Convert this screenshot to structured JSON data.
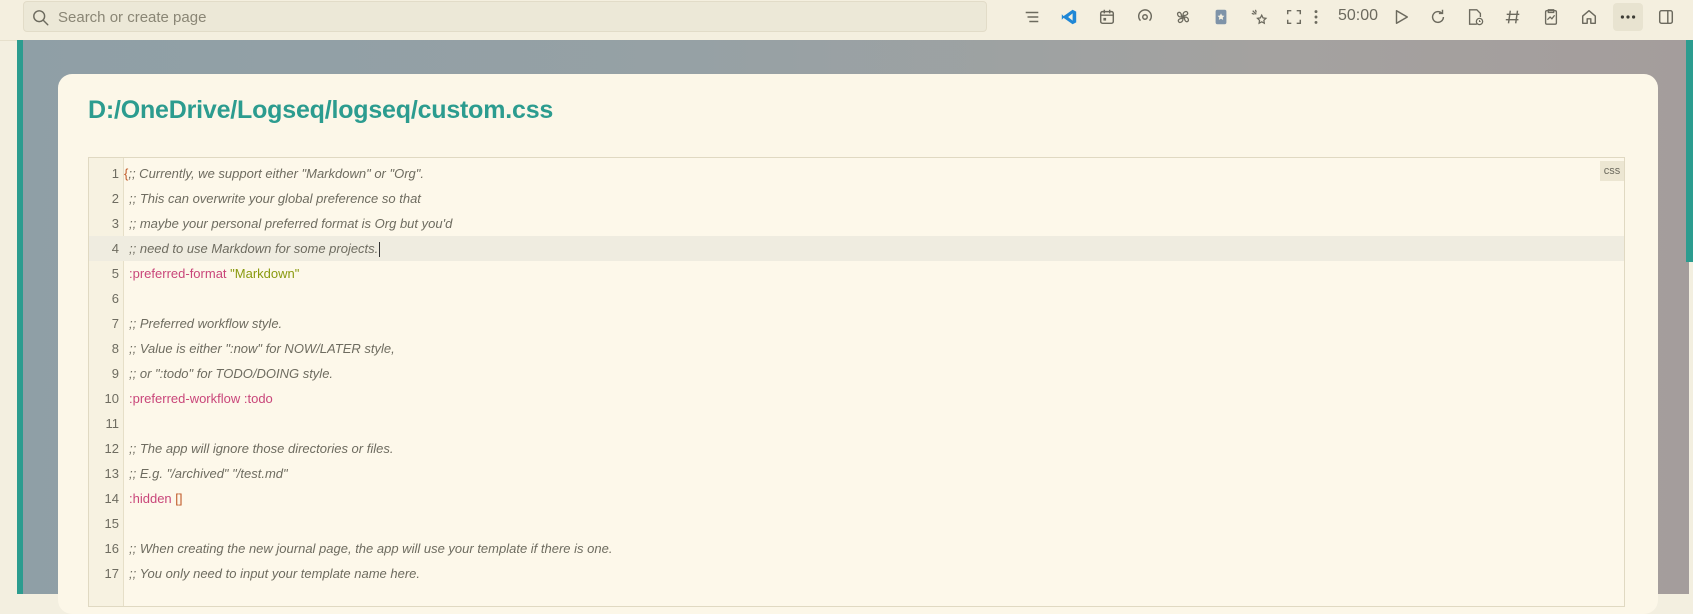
{
  "search": {
    "placeholder": "Search or create page"
  },
  "toolbar": {
    "icons": [
      "list-icon",
      "vscode-icon",
      "calendar-icon",
      "podcast-icon",
      "fan-icon",
      "bookmark-icon",
      "stars-icon",
      "fullscreen-icon",
      "vertical-dots-icon",
      "play-icon",
      "refresh-icon",
      "page-clock-icon",
      "hashtag-icon",
      "clipboard-chart-icon",
      "home-icon",
      "more-icon",
      "sidebar-toggle-icon"
    ],
    "timer": "50:00",
    "more_label": "···"
  },
  "page": {
    "title": "D:/OneDrive/Logseq/logseq/custom.css"
  },
  "editor": {
    "language": "css",
    "active_line": 4,
    "lines": [
      {
        "n": "1",
        "first": "{",
        "text": ";; Currently, we support either \"Markdown\" or \"Org\"."
      },
      {
        "n": "2",
        "text": ";; This can overwrite your global preference so that"
      },
      {
        "n": "3",
        "text": ";; maybe your personal preferred format is Org but you'd"
      },
      {
        "n": "4",
        "text": ";; need to use Markdown for some projects."
      },
      {
        "n": "5",
        "key": ":preferred-format",
        "value": "\"Markdown\""
      },
      {
        "n": "6",
        "text": ""
      },
      {
        "n": "7",
        "text": ";; Preferred workflow style."
      },
      {
        "n": "8",
        "text": ";; Value is either \":now\" for NOW/LATER style,"
      },
      {
        "n": "9",
        "text": ";; or \":todo\" for TODO/DOING style."
      },
      {
        "n": "10",
        "key": ":preferred-workflow :todo"
      },
      {
        "n": "11",
        "text": ""
      },
      {
        "n": "12",
        "text": ";; The app will ignore those directories or files."
      },
      {
        "n": "13",
        "text": ";; E.g. \"/archived\" \"/test.md\""
      },
      {
        "n": "14",
        "key": ":hidden",
        "brace": "[]"
      },
      {
        "n": "15",
        "text": ""
      },
      {
        "n": "16",
        "text": ";; When creating the new journal page, the app will use your template if there is one."
      },
      {
        "n": "17",
        "text": ";; You only need to input your template name here."
      }
    ]
  },
  "colors": {
    "accent": "#2c9c8f",
    "comment": "#6e6c60",
    "keyword": "#c9467a",
    "string": "#8a9a10"
  }
}
